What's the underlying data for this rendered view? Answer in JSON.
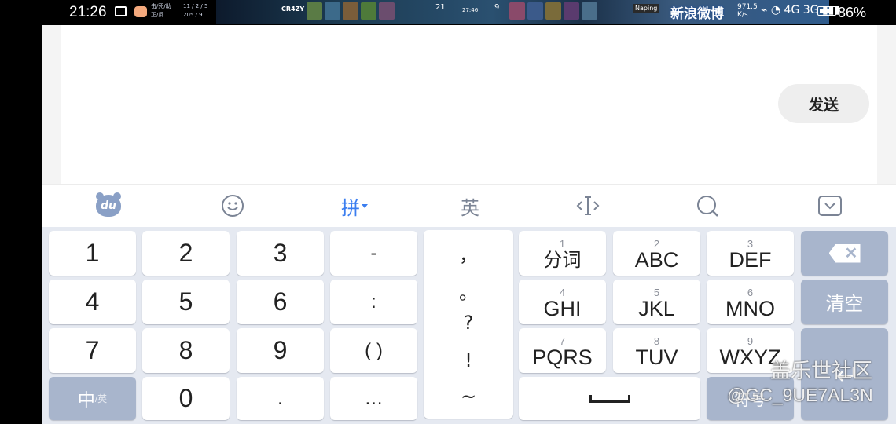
{
  "status_bar": {
    "time": "21:26",
    "game_stats_labels": "击/死/助\n正/反",
    "game_stats_values": "11 / 2 / 5\n205 / 9",
    "team_logo": "CR4ZY",
    "score": "21",
    "clock": "27:46",
    "score_right": "9",
    "sponsor": "Naping",
    "weibo_overlay": "新浪微博",
    "net_speed": "971.5\nK/s",
    "signal_icons": "⌁ ◔ 4G 3G ▮▮▮",
    "battery": "86%"
  },
  "app": {
    "send_label": "发送"
  },
  "toolbar": {
    "logo_text": "du",
    "pinyin_label": "拼",
    "english_label": "英"
  },
  "keyboard": {
    "num_keys": [
      "1",
      "2",
      "3",
      "4",
      "5",
      "6",
      "7",
      "8",
      "9",
      "0"
    ],
    "sym_col": [
      "-",
      ":",
      "( )",
      "."
    ],
    "ellipsis": "…",
    "panel_symbols": [
      "，",
      "。",
      "?",
      "!",
      "~"
    ],
    "t9": [
      {
        "digit": "1",
        "letters": "分词"
      },
      {
        "digit": "2",
        "letters": "ABC"
      },
      {
        "digit": "3",
        "letters": "DEF"
      },
      {
        "digit": "4",
        "letters": "GHI"
      },
      {
        "digit": "5",
        "letters": "JKL"
      },
      {
        "digit": "6",
        "letters": "MNO"
      },
      {
        "digit": "7",
        "letters": "PQRS"
      },
      {
        "digit": "8",
        "letters": "TUV"
      },
      {
        "digit": "9",
        "letters": "WXYZ"
      }
    ],
    "clear_label": "清空",
    "zh_label": "中",
    "zh_sub": "/英",
    "symbol_key_label": "符号"
  },
  "watermark": {
    "line1": "盖乐世社区",
    "line2": "@GC_9UE7AL3N"
  },
  "colors": {
    "accent": "#3b7ef0",
    "gray_key": "#a8b5cc",
    "keyboard_bg": "#e5e9f1"
  }
}
